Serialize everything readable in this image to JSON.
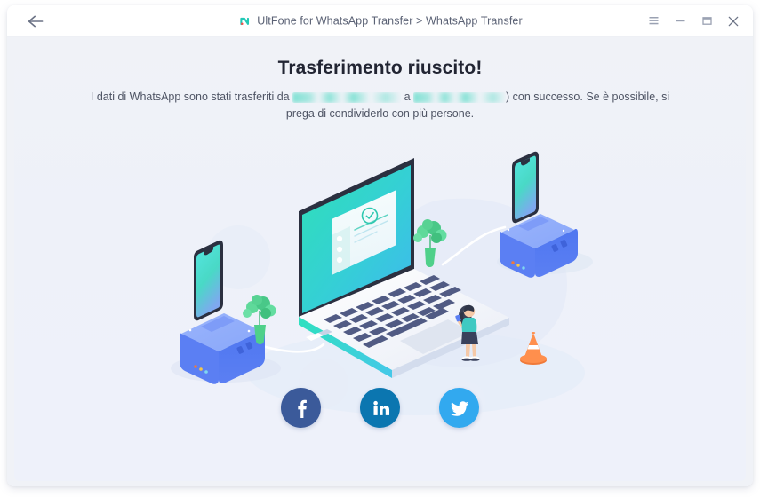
{
  "window": {
    "title": "UltFone for WhatsApp Transfer > WhatsApp Transfer",
    "logo_icon": "ultfone-logo-icon",
    "back_icon": "arrow-left-icon",
    "controls": [
      {
        "name": "menu-button",
        "icon": "hamburger-menu-icon",
        "label": "☰"
      },
      {
        "name": "minimize-button",
        "icon": "minimize-icon",
        "label": "–"
      },
      {
        "name": "maximize-button",
        "icon": "maximize-icon",
        "label": "☐"
      },
      {
        "name": "close-button",
        "icon": "close-icon",
        "label": "✕"
      }
    ]
  },
  "main": {
    "headline": "Trasferimento riuscito!",
    "message_part_1": "I dati di WhatsApp sono stati trasferiti da",
    "source_device": "",
    "message_part_2": "a",
    "target_device": "",
    "message_part_3": ") con successo. Se è possibile, si prega di condividerlo con più persone."
  },
  "illustration": {
    "name": "isometric-phone-to-laptop-transfer-illustration",
    "elements": [
      "laptop",
      "left-phone-dock",
      "right-phone-dock",
      "plant-left",
      "plant-right",
      "person",
      "traffic-cone",
      "usb-cable"
    ]
  },
  "social": [
    {
      "name": "share-facebook-button",
      "icon": "facebook-icon",
      "label": "f",
      "color": "#3b5a9a"
    },
    {
      "name": "share-linkedin-button",
      "icon": "linkedin-icon",
      "label": "in",
      "color": "#0b76b0"
    },
    {
      "name": "share-twitter-button",
      "icon": "twitter-icon",
      "label": "t",
      "color": "#32a9ef"
    }
  ],
  "colors": {
    "background": "#f0f2f7",
    "panel": "#eef1f9",
    "accent_teal": "#2fd3c0",
    "accent_blue": "#5b7cf5",
    "heading": "#222533",
    "body_text": "#4e5464",
    "title_text": "#5b6275"
  }
}
